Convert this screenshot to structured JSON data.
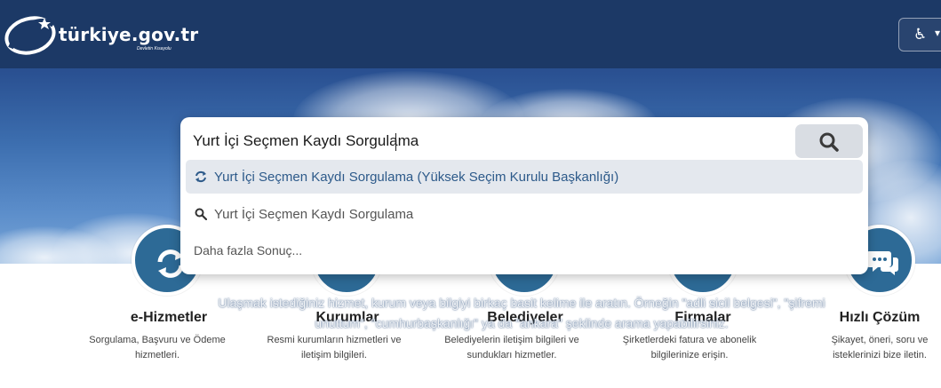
{
  "header": {
    "logo_text": "türkiye.gov.tr",
    "logo_tagline": "Devletin Kısayolu",
    "accessibility_icon": "wheelchair-icon"
  },
  "search": {
    "query": "Yurt İçi Seçmen Kaydı Sorgulama",
    "button_icon": "search-icon",
    "suggestions": [
      {
        "icon": "refresh-icon",
        "label": "Yurt İçi Seçmen Kaydı Sorgulama (Yüksek Seçim Kurulu Başkanlığı)"
      },
      {
        "icon": "search-icon",
        "label": "Yurt İçi Seçmen Kaydı Sorgulama"
      }
    ],
    "more_label": "Daha fazla Sonuç...",
    "hint": "Ulaşmak istediğiniz hizmet, kurum veya bilgiyi birkaç basit kelime ile aratın. Örneğin \"adli sicil belgesi\", \"şifremi unuttum\", \"cumhurbaşkanlığı\" ya da \"ankara\" şeklinde arama yapabilirsiniz."
  },
  "categories": [
    {
      "title": "e-Hizmetler",
      "desc_line1": "Sorgulama, Başvuru ve Ödeme",
      "desc_line2": "hizmetleri."
    },
    {
      "title": "Kurumlar",
      "desc_line1": "Resmi kurumların hizmetleri ve",
      "desc_line2": "iletişim bilgileri."
    },
    {
      "title": "Belediyeler",
      "desc_line1": "Belediyelerin iletişim bilgileri ve",
      "desc_line2": "sundukları hizmetler."
    },
    {
      "title": "Firmalar",
      "desc_line1": "Şirketlerdeki fatura ve abonelik",
      "desc_line2": "bilgilerinize erişin."
    },
    {
      "title": "Hızlı Çözüm",
      "desc_line1": "Şikayet, öneri, soru ve",
      "desc_line2": "isteklerinizi bize iletin."
    }
  ],
  "colors": {
    "header_bg": "#1c3966",
    "accent": "#2d6a96",
    "suggestion_active_text": "#2d5a8a"
  }
}
